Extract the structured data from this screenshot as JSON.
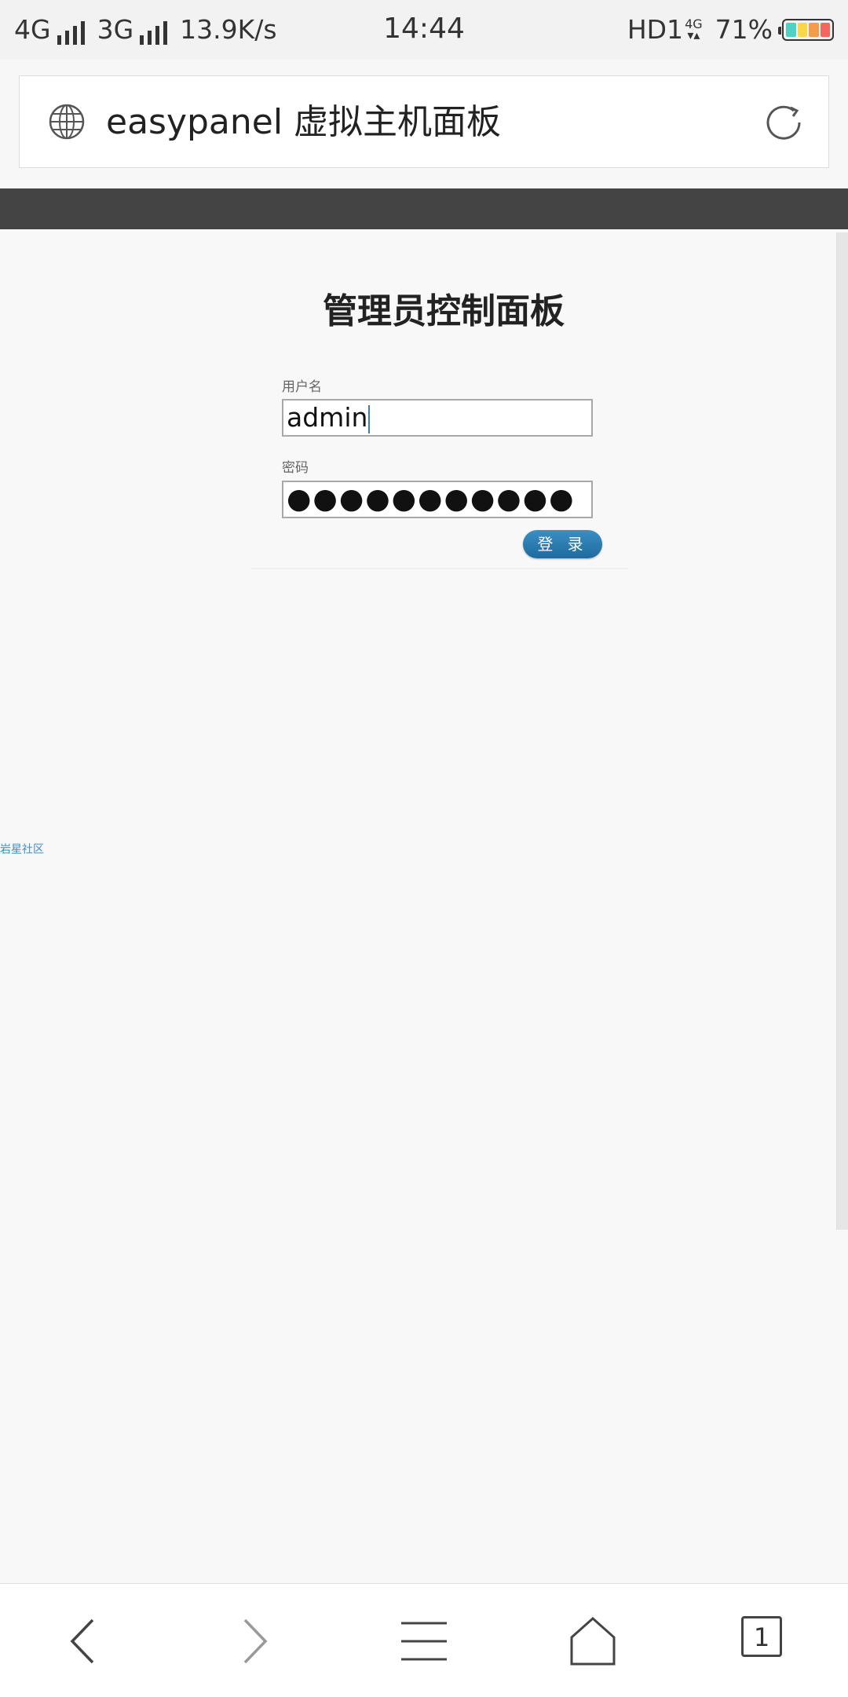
{
  "status_bar": {
    "net1": "4G",
    "net2": "3G",
    "speed": "13.9K/s",
    "time": "14:44",
    "hd": "HD1",
    "net_4g_small": "4G",
    "battery": "71%"
  },
  "address_bar": {
    "title": "easypanel 虚拟主机面板"
  },
  "login": {
    "heading": "管理员控制面板",
    "username_label": "用户名",
    "username_value": "admin",
    "password_label": "密码",
    "password_mask": "●●●●●●●●●●●",
    "submit": "登 录"
  },
  "side_link": "岩星社区",
  "bottom_nav": {
    "tab_count": "1"
  },
  "colors": {
    "header": "#444444",
    "button": "#2a7cb3",
    "link": "#3a8fc5"
  }
}
